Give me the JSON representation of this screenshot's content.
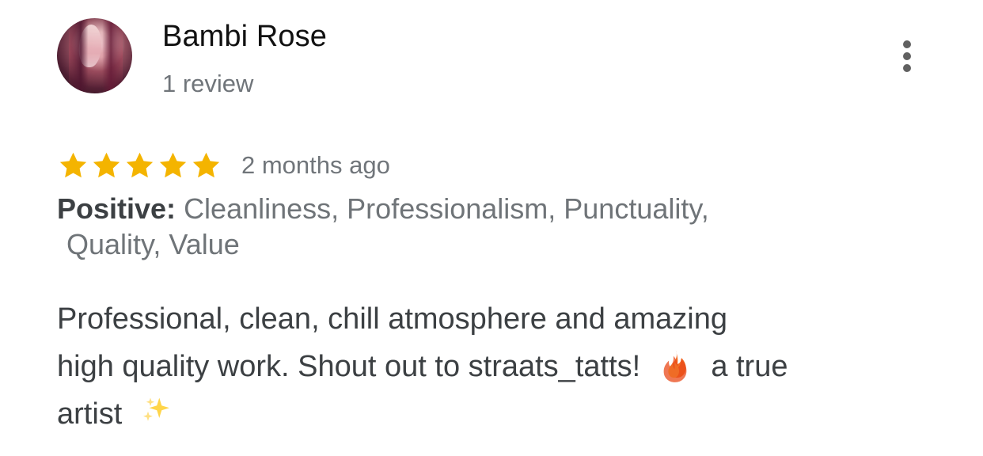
{
  "review": {
    "reviewer": {
      "name": "Bambi Rose",
      "review_count": "1 review",
      "avatar_icon": "profile-photo-avatar"
    },
    "menu_icon": "more-vert-icon",
    "rating": {
      "stars": 5,
      "max": 5,
      "star_color": "#F4B400",
      "time": "2 months ago"
    },
    "positive": {
      "label": "Positive:",
      "text": "Cleanliness, Professionalism, Punctuality,",
      "text_line_2": "Quality, Value"
    },
    "body": {
      "line1": "Professional, clean, chill atmosphere and amazing",
      "line2_part1": "high quality work. Shout out to straats_tatts!",
      "line2_part2": "a true",
      "line3_part1": "artist",
      "emoji_1": "fire-icon",
      "emoji_2": "sparkles-icon"
    },
    "colors": {
      "text_primary": "#3C4043",
      "text_secondary": "#70757A",
      "name": "#111111",
      "star": "#F4B400"
    }
  }
}
